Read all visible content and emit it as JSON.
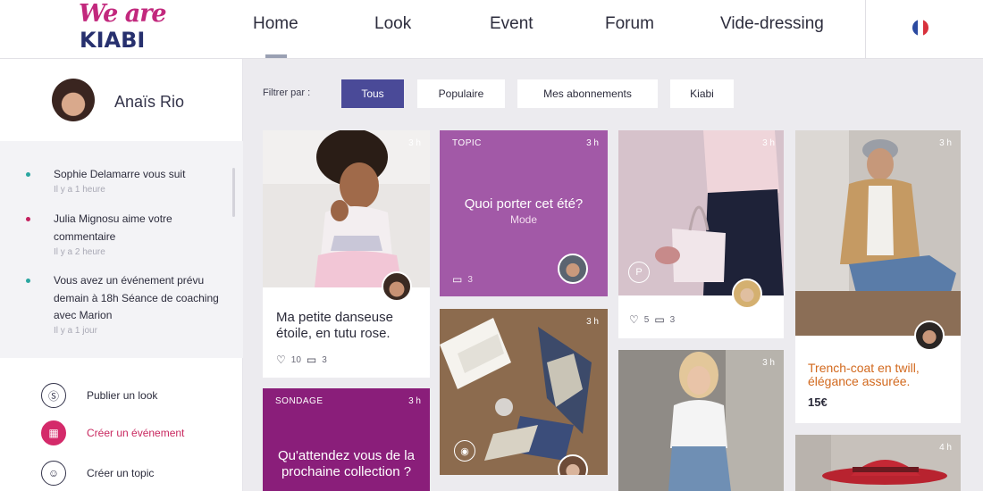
{
  "brand": {
    "line1": "We are",
    "line2": "KIABI"
  },
  "nav": {
    "items": [
      "Home",
      "Look",
      "Event",
      "Forum",
      "Vide-dressing"
    ],
    "active": "Home"
  },
  "language_flag": "flag-icon-fr",
  "user": {
    "name": "Anaïs Rio"
  },
  "notifications": [
    {
      "text": "Sophie Delamarre vous suit",
      "time": "Il y a 1 heure",
      "dot_color": "#2aa6a0"
    },
    {
      "text": "Julia Mignosu aime votre commentaire",
      "time": "Il y a 2 heure",
      "dot_color": "#c4205e"
    },
    {
      "text": "Vous avez un événement prévu demain à 18h Séance de coaching avec Marion",
      "time": "Il y a 1 jour",
      "dot_color": "#2aa6a0"
    }
  ],
  "actions": [
    {
      "label": "Publier un look",
      "icon": "hanger-icon",
      "glyph": "Ⓢ"
    },
    {
      "label": "Créer un événement",
      "icon": "calendar-icon",
      "glyph": "▦"
    },
    {
      "label": "Créer un topic",
      "icon": "chat-icon",
      "glyph": "☺"
    }
  ],
  "filters": {
    "label": "Filtrer par :",
    "options": [
      "Tous",
      "Populaire",
      "Mes abonnements",
      "Kiabi"
    ],
    "active": "Tous"
  },
  "cards": {
    "girl": {
      "time": "3 h",
      "title_line1": "Ma petite danseuse",
      "title_line2": "étoile, en tutu rose.",
      "likes": "10",
      "comments": "3"
    },
    "topic": {
      "tag": "TOPIC",
      "time": "3 h",
      "title": "Quoi porter cet été?",
      "sub": "Mode",
      "comments": "3"
    },
    "pink_bag": {
      "time": "3 h",
      "likes": "5",
      "comments": "3"
    },
    "man": {
      "time": "3 h",
      "title_line1": "Trench-coat en twill,",
      "title_line2": "élégance assurée.",
      "price": "15€"
    },
    "sondage": {
      "tag": "SONDAGE",
      "time": "3 h",
      "title_line1": "Qu'attendez vous de la",
      "title_line2": "prochaine collection ?"
    },
    "shoes": {
      "time": "3 h"
    },
    "blonde": {
      "time": "3 h"
    },
    "hat": {
      "time": "4 h"
    }
  },
  "colors": {
    "accent_purple": "#4a4a98",
    "topic_purple": "#a259a7",
    "sondage_purple": "#8a1e7a",
    "trench_orange": "#d2691e",
    "brand_pink": "#c2287d",
    "brand_navy": "#27306e"
  }
}
